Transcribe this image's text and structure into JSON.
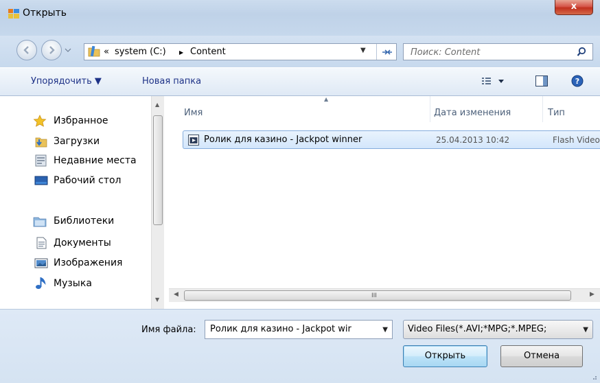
{
  "window": {
    "title": "Открыть",
    "close_label": "x"
  },
  "address": {
    "overflow": "«",
    "crumbs": [
      "system (C:)",
      "Content"
    ],
    "separator": "▶"
  },
  "search": {
    "placeholder": "Поиск: Content"
  },
  "toolbar": {
    "organize_label": "Упорядочить ▼",
    "new_folder_label": "Новая папка"
  },
  "nav": {
    "favorites": "Избранное",
    "downloads": "Загрузки",
    "recent": "Недавние места",
    "desktop": "Рабочий стол",
    "libraries": "Библиотеки",
    "documents": "Документы",
    "pictures": "Изображения",
    "music": "Музыка"
  },
  "columns": {
    "name": "Имя",
    "date": "Дата изменения",
    "type": "Тип"
  },
  "files": [
    {
      "name": "Ролик для казино - Jackpot winner",
      "date": "25.04.2013 10:42",
      "type": "Flash Video"
    }
  ],
  "scroll_grip": "III",
  "footer": {
    "filename_label": "Имя файла:",
    "filename_value": "Ролик для казино - Jackpot wir",
    "filetype_value": "Video Files(*.AVI;*MPG;*.MPEG;",
    "open_label": "Открыть",
    "cancel_label": "Отмена"
  },
  "icons": [
    "window-icon",
    "back-icon",
    "forward-icon",
    "folder-icon",
    "refresh-icon",
    "search-icon",
    "views-icon",
    "preview-pane-icon",
    "help-icon",
    "star-icon",
    "downloads-icon",
    "recent-places-icon",
    "desktop-icon",
    "libraries-icon",
    "documents-icon",
    "pictures-icon",
    "music-icon",
    "video-file-icon"
  ]
}
